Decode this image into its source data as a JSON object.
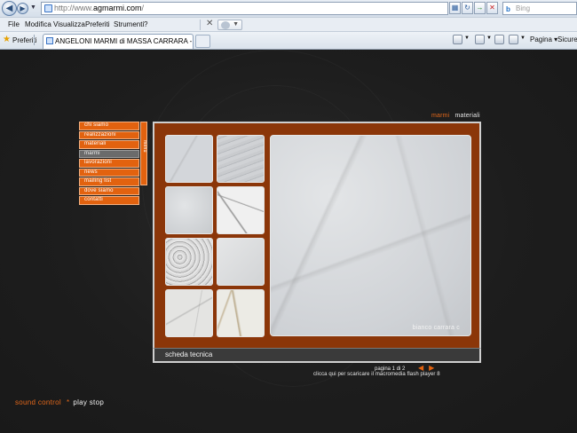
{
  "browser": {
    "url_prefix": "http://www.",
    "url_host": "agmarmi.com",
    "url_suffix": "/",
    "search_placeholder": "Bing",
    "menu": [
      "File",
      "Modifica",
      "Visualizza",
      "Preferiti",
      "Strumenti",
      "?"
    ],
    "favorites_label": "Preferiti",
    "tab_title": "ANGELONI MARMI di MASSA CARRARA - LAVORAZIO...",
    "commands": {
      "page": "Pagina",
      "security": "Sicurez"
    }
  },
  "site": {
    "topnav": {
      "marmi": "marmi",
      "materiali": "materiali"
    },
    "menu_items": [
      "chi siamo",
      "realizzazioni",
      "materiali",
      "marmi",
      "lavorazioni",
      "news",
      "mailing list",
      "dove siamo",
      "contatti"
    ],
    "menu_active_index": 3,
    "menu_tab_label": "menu",
    "main_caption": "bianco carrara c",
    "scheda_label": "scheda tecnica",
    "pagination": "pagina 1 di 2",
    "flash_link": "clicca qui per scaricare il macromedia flash player 8",
    "sound_label": "sound control",
    "sound_star": "*",
    "sound_play_stop": "play stop"
  },
  "colors": {
    "accent": "#e2620f",
    "frame": "#8b3609",
    "page_bg": "#1c1c1c"
  },
  "thumbnails": [
    "marble-white-1",
    "marble-veined-grey",
    "marble-white-2",
    "marble-calacatta",
    "marble-arabescato",
    "marble-white-smooth",
    "marble-statuario",
    "marble-cream-veined"
  ]
}
